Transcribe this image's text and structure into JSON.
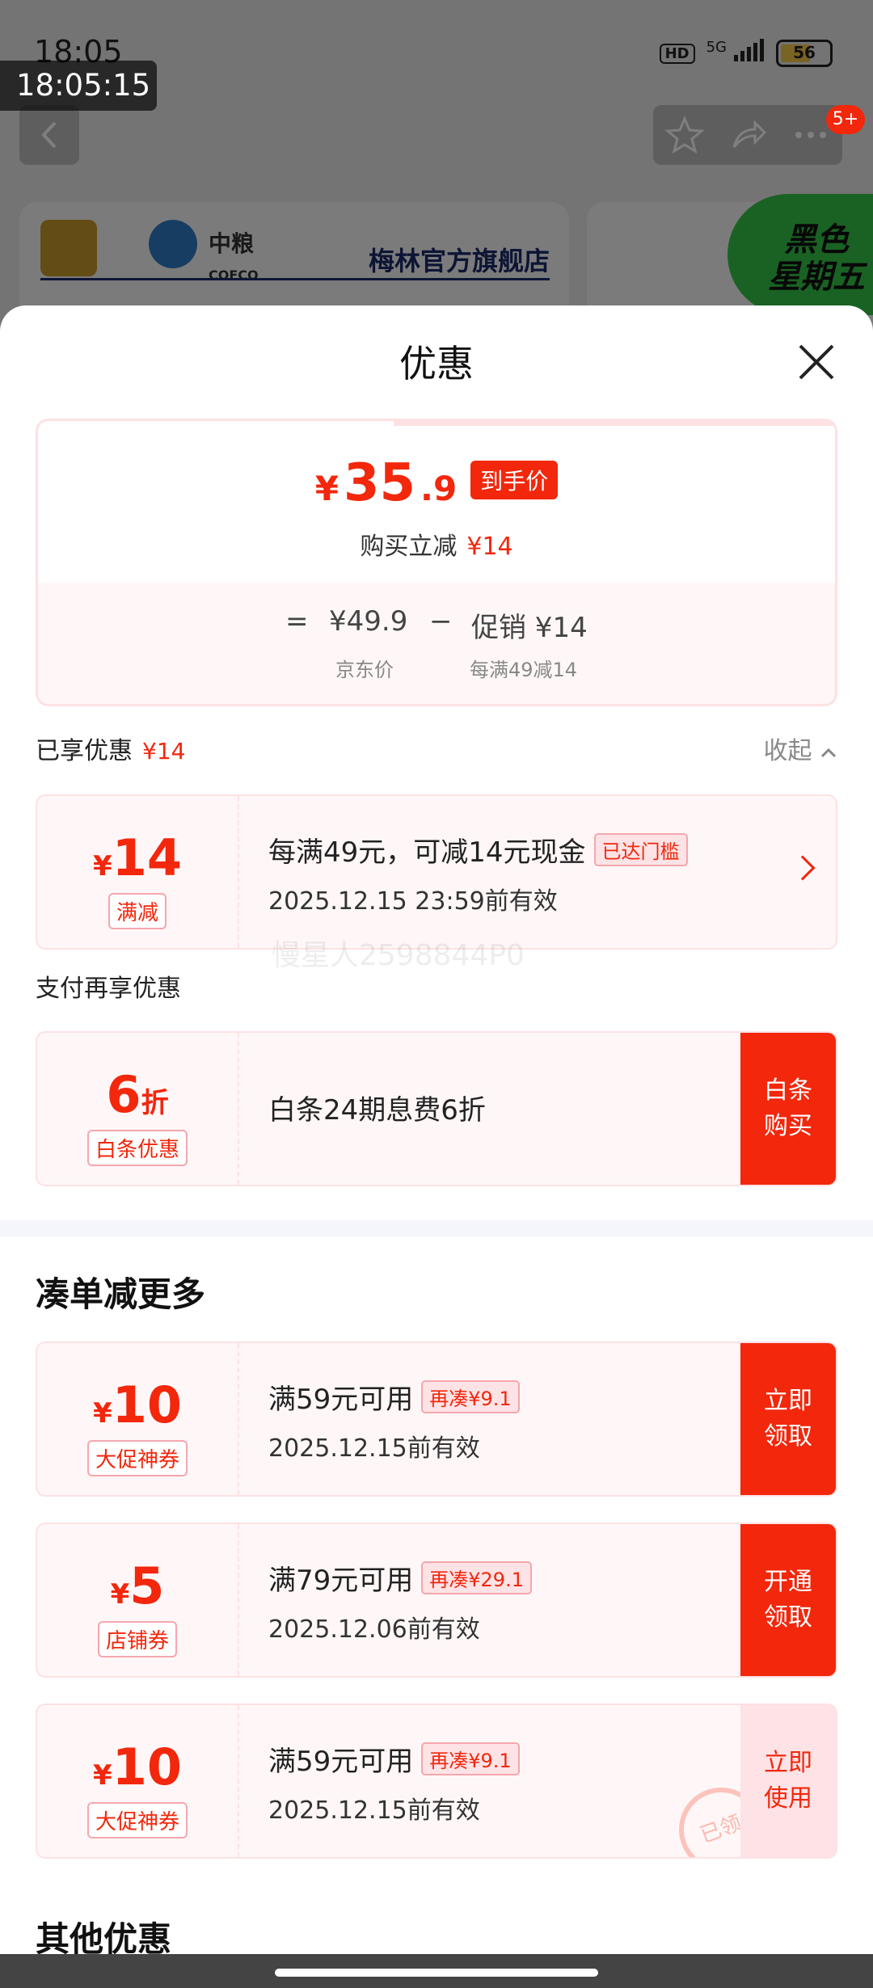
{
  "status_bar": {
    "time": "18:05",
    "signal": "5G",
    "battery": "56",
    "hd": "HD"
  },
  "time_overlay": "18:05:15",
  "cart_badge": "5+",
  "store": {
    "brand": "中粮",
    "brand_en": "COFCO",
    "name": "梅林官方旗舰店"
  },
  "promo_badge": [
    "黑色",
    "星期五"
  ],
  "sheet": {
    "title": "优惠",
    "price": {
      "yen": "¥",
      "int": "35",
      "dec": ".9",
      "tag": "到手价",
      "reduce_label": "购买立减",
      "reduce_value": "¥14",
      "equals": "=",
      "jd_price": "¥49.9",
      "minus": "−",
      "promo_label": "促销 ¥14",
      "jd_price_label": "京东价",
      "promo_sub": "每满49减14"
    },
    "enjoyed": {
      "label": "已享优惠",
      "value": "¥14",
      "collapse": "收起"
    },
    "coupon_fullcut": {
      "yen": "¥",
      "amount": "14",
      "tag": "满减",
      "title": "每满49元，可减14元现金",
      "chip": "已达门槛",
      "date": "2025.12.15 23:59前有效"
    },
    "watermark": "慢星人2598844P0",
    "pay_section": "支付再享优惠",
    "coupon_baitiao": {
      "amount": "6",
      "unit": "折",
      "tag": "白条优惠",
      "title": "白条24期息费6折",
      "action": [
        "白条",
        "购买"
      ]
    },
    "more_section": "凑单减更多",
    "more_coupons": [
      {
        "yen": "¥",
        "amount": "10",
        "tag": "大促神券",
        "title": "满59元可用",
        "chip": "再凑¥9.1",
        "date": "2025.12.15前有效",
        "action": [
          "立即",
          "领取"
        ],
        "style": "solid"
      },
      {
        "yen": "¥",
        "amount": "5",
        "tag": "店铺券",
        "title": "满79元可用",
        "chip": "再凑¥29.1",
        "date": "2025.12.06前有效",
        "action": [
          "开通",
          "领取"
        ],
        "style": "solid"
      },
      {
        "yen": "¥",
        "amount": "10",
        "tag": "大促神券",
        "title": "满59元可用",
        "chip": "再凑¥9.1",
        "date": "2025.12.15前有效",
        "action": [
          "立即",
          "使用"
        ],
        "style": "light",
        "stamp": "已领"
      }
    ],
    "other_section": "其他优惠"
  }
}
